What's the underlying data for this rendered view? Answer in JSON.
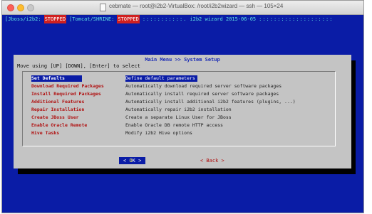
{
  "window": {
    "title": "cebmate — root@i2b2-VirtualBox: /root/i2b2wizard — ssh — 105×24"
  },
  "statusbar": {
    "left": "[Jboss/i2b2:",
    "left_status": "STOPPED",
    "middle": "[Tomcat/SHRINE:",
    "middle_status": "STOPPED",
    "dots": ":::::::::::.",
    "right": "i2b2 wizard 2015-06-05",
    "dots_right": "::::::::::::::::::::"
  },
  "dialog": {
    "title": "Main Menu >> System Setup",
    "instruction": "Move using [UP] [DOWN], [Enter] to select",
    "menu": [
      {
        "tag": "Set Defaults",
        "desc": "Define default parameters",
        "selected": true
      },
      {
        "tag": "Download Required Packages",
        "desc": "Automatically download required server software packages"
      },
      {
        "tag": "Install Required Packages",
        "desc": "Automatically install required server software packages"
      },
      {
        "tag": "Additional Features",
        "desc": "Automatically install additional i2b2 features (plugins, ...)"
      },
      {
        "tag": "Repair Installation",
        "desc": "Automatically repair i2b2 installation"
      },
      {
        "tag": "Create JBoss User",
        "desc": "Create a separate Linux User for JBoss"
      },
      {
        "tag": "Enable Oracle Remote",
        "desc": "Enable Oracle DB remote HTTP access"
      },
      {
        "tag": "Hive Tasks",
        "desc": "Modify i2b2 Hive options"
      }
    ],
    "buttons": {
      "ok_left": "<",
      "ok_hot": "O",
      "ok_rest": "K >",
      "back": "< Back >"
    }
  },
  "colors": {
    "terminal_bg": "#0a1ca6",
    "dialog_bg": "#c4c4c4",
    "tag_red": "#b01010",
    "status_red": "#d02020"
  }
}
